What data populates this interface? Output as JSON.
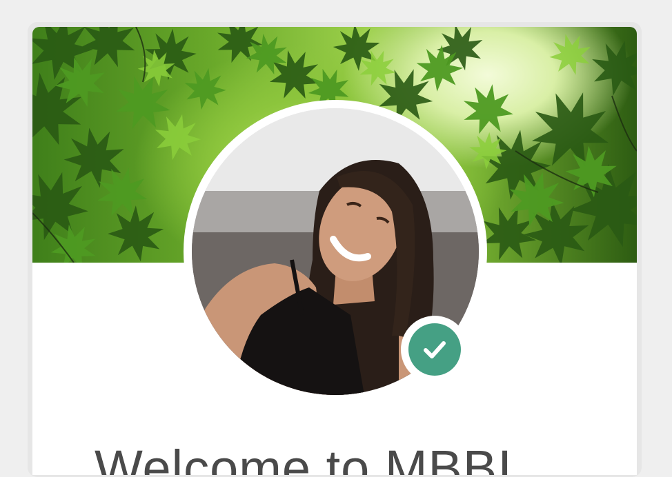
{
  "profile": {
    "cover_image": "green-maple-leaves-cover",
    "avatar_image": "smiling-woman-portrait",
    "verified_icon": "check-icon",
    "verified_color": "#45a084",
    "welcome_text": "Welcome to MBBI"
  },
  "colors": {
    "page_background": "#efefef",
    "card_background": "#ffffff",
    "text": "#4a4a4a"
  }
}
